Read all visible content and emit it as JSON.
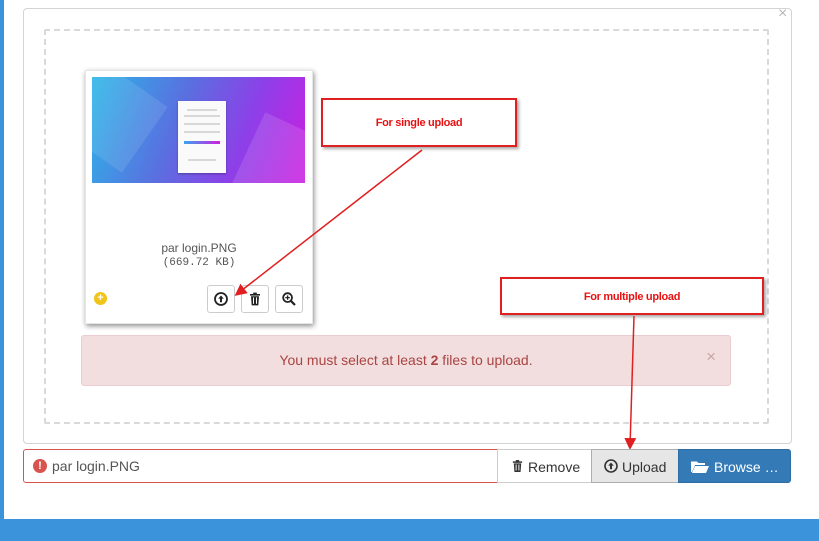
{
  "uploader": {
    "close_glyph": "×",
    "file": {
      "name": "par login.PNG",
      "size": "(669.72 KB)"
    },
    "thumb_actions": [
      "upload-icon",
      "trash-icon",
      "zoom-icon"
    ],
    "alert": {
      "text_before": "You must select at least ",
      "count": "2",
      "text_after": " files to upload.",
      "close_glyph": "×"
    },
    "caption": {
      "icon": "!",
      "filename": "par login.PNG"
    },
    "buttons": {
      "remove": "Remove",
      "upload": "Upload",
      "browse": "Browse …"
    }
  },
  "annotations": {
    "single": "For single upload",
    "multiple": "For multiple upload"
  },
  "colors": {
    "accent": "#337ab7",
    "danger": "#d9534f",
    "callout": "#e02020",
    "page_bg": "#3b93dc"
  }
}
